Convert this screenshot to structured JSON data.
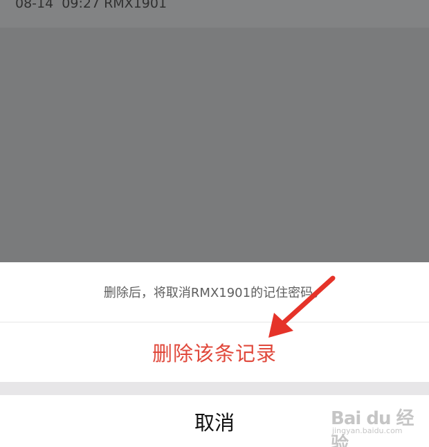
{
  "background": {
    "record_line": "08-14  09:27 RMX1901"
  },
  "dialog": {
    "message": "删除后，将取消RMX1901的记住密码。",
    "delete_label": "删除该条记录",
    "cancel_label": "取消"
  },
  "watermark": {
    "main": "Bai du 经验",
    "sub": "jingyan.baidu.com"
  },
  "colors": {
    "delete_text": "#e0483b",
    "arrow": "#e53329",
    "overlay": "#7a7b7c"
  },
  "icons": {
    "arrow": "red-arrow-annotation-icon",
    "watermark": "baidu-paw-logo"
  }
}
